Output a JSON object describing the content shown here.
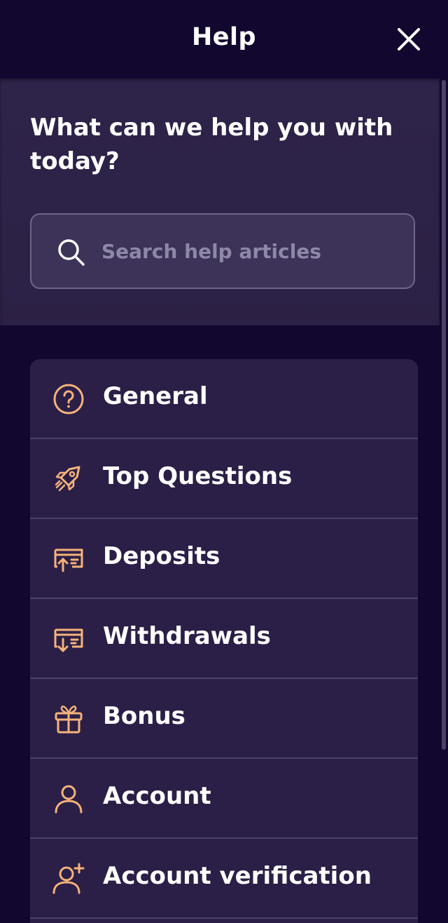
{
  "header": {
    "title": "Help"
  },
  "search_panel": {
    "heading": "What can we help you with today?",
    "search": {
      "placeholder": "Search help articles",
      "value": ""
    }
  },
  "categories": [
    {
      "label": "General",
      "icon": "question-circle-icon"
    },
    {
      "label": "Top Questions",
      "icon": "rocket-icon"
    },
    {
      "label": "Deposits",
      "icon": "deposit-icon"
    },
    {
      "label": "Withdrawals",
      "icon": "withdrawal-icon"
    },
    {
      "label": "Bonus",
      "icon": "gift-icon"
    },
    {
      "label": "Account",
      "icon": "user-icon"
    },
    {
      "label": "Account verification",
      "icon": "user-plus-icon"
    }
  ],
  "colors": {
    "background": "#12072e",
    "panel": "#2e2349",
    "card": "#2b1f47",
    "accent_icon": "#f5b27a",
    "text": "#ffffff",
    "placeholder": "#8e88a6"
  }
}
